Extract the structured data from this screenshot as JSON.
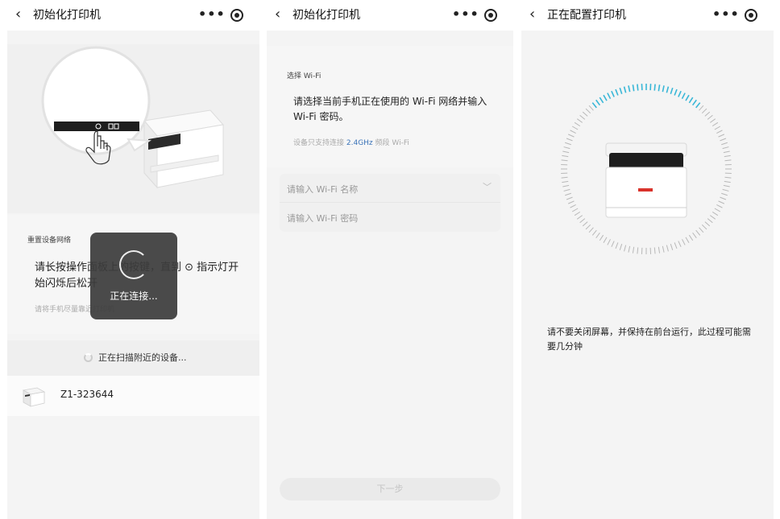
{
  "screens": [
    {
      "title": "初始化打印机",
      "section_label": "重置设备网络",
      "instruction": "请长按操作面板上的按键，直到 ⊙ 指示灯开始闪烁后松开",
      "hint": "请将手机尽量靠近打印机",
      "scan_status": "正在扫描附近的设备...",
      "device": {
        "name": "Z1-323644"
      },
      "toast": "正在连接..."
    },
    {
      "title": "初始化打印机",
      "section_label": "选择 Wi-Fi",
      "instruction": "请选择当前手机正在使用的 Wi-Fi 网络并输入 Wi-Fi 密码。",
      "hint_prefix": "设备只支持连接 ",
      "hint_highlight": "2.4GHz",
      "hint_suffix": " 频段 Wi-Fi",
      "wifi_name_placeholder": "请输入 Wi-Fi 名称",
      "wifi_password_placeholder": "请输入 Wi-Fi 密码",
      "next_label": "下一步"
    },
    {
      "title": "正在配置打印机",
      "message": "请不要关闭屏幕，并保持在前台运行，此过程可能需要几分钟"
    }
  ],
  "icons": {
    "back": "chevron-left-icon",
    "more": "more-dots-icon",
    "target": "target-icon",
    "spinner": "spinner-icon",
    "dropdown": "chevron-down-icon"
  },
  "colors": {
    "accent_red": "#d9322b",
    "hint_blue": "#3a73b8",
    "ring_blue": "#39b7d7"
  }
}
